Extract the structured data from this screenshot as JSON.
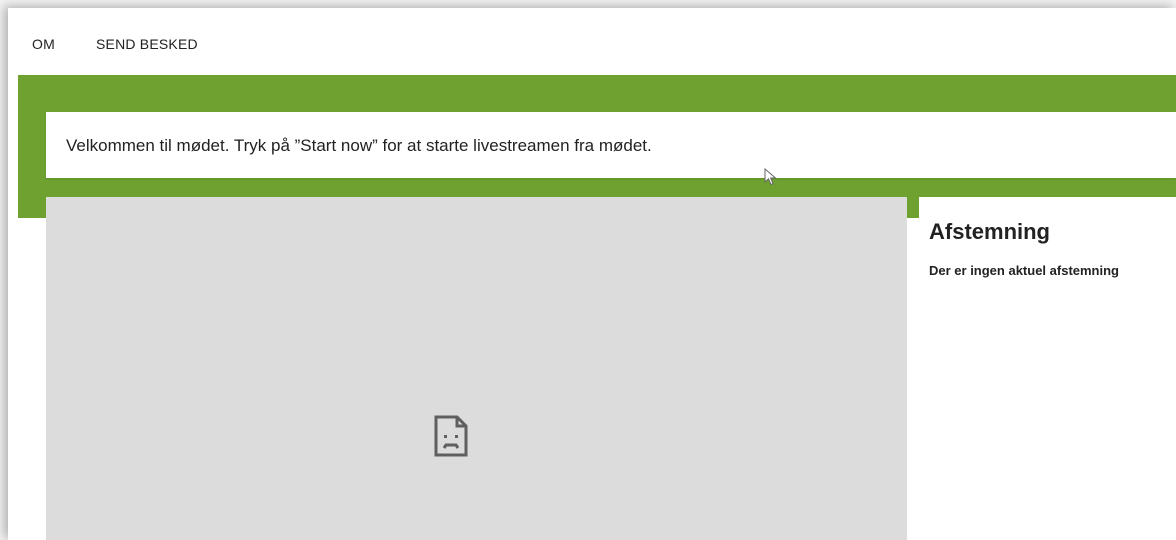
{
  "nav": {
    "items": [
      {
        "label": "OM"
      },
      {
        "label": "SEND BESKED"
      }
    ]
  },
  "welcome": {
    "message": "Velkommen til mødet. Tryk på ”Start now” for at starte livestreamen fra mødet."
  },
  "video": {
    "icon": "sad-page-icon"
  },
  "panel": {
    "title": "Afstemning",
    "status": "Der er ingen aktuel afstemning"
  },
  "colors": {
    "accent_green": "#6ea12f",
    "video_placeholder": "#dcdcdc"
  }
}
